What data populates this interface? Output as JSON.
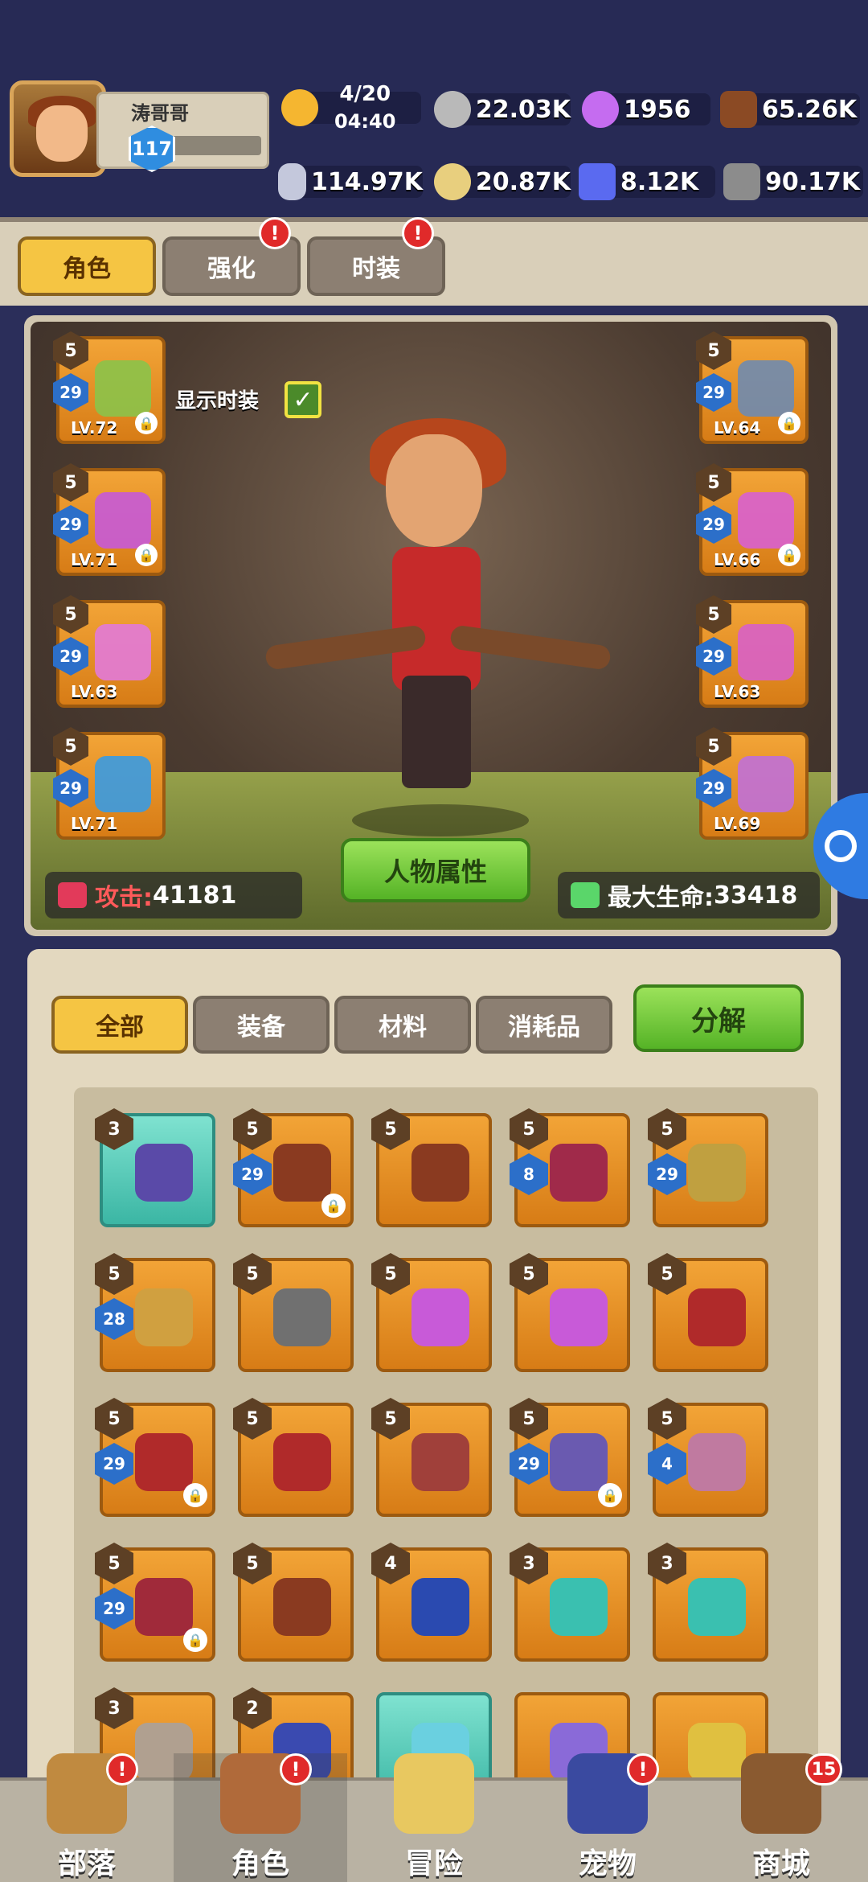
{
  "player": {
    "name": "涛哥哥",
    "level": "117"
  },
  "resources": {
    "energy": {
      "value": "4/20",
      "timer": "04:40",
      "icon": "energy-drumstick-icon",
      "color": "#f5b630"
    },
    "silver": {
      "value": "22.03K",
      "icon": "stone-coin-icon",
      "color": "#b9b9b9"
    },
    "gem": {
      "value": "1956",
      "icon": "purple-orb-icon",
      "color": "#c56cf0"
    },
    "wood": {
      "value": "65.26K",
      "icon": "wood-log-icon",
      "color": "#8b4a24"
    },
    "bone": {
      "value": "114.97K",
      "icon": "bone-icon",
      "color": "#c4c8dc"
    },
    "egg": {
      "value": "20.87K",
      "icon": "gold-egg-icon",
      "color": "#e8cf7e"
    },
    "crystal": {
      "value": "8.12K",
      "icon": "blue-crystal-icon",
      "color": "#5a6af0"
    },
    "ore": {
      "value": "90.17K",
      "icon": "grey-ore-icon",
      "color": "#8c8c8c"
    }
  },
  "tabs": [
    {
      "label": "角色",
      "active": true,
      "alert": false
    },
    {
      "label": "强化",
      "active": false,
      "alert": true
    },
    {
      "label": "时装",
      "active": false,
      "alert": true
    }
  ],
  "alert_mark": "!",
  "costume_toggle": {
    "label": "显示时装",
    "checked": true,
    "check_mark": "✓"
  },
  "equipped_left": [
    {
      "tier": "5",
      "rank": "29",
      "level": "LV.72",
      "locked": true,
      "color": "#8bc34a"
    },
    {
      "tier": "5",
      "rank": "29",
      "level": "LV.71",
      "locked": true,
      "color": "#c65ad8"
    },
    {
      "tier": "5",
      "rank": "29",
      "level": "LV.63",
      "locked": false,
      "color": "#e27ad8"
    },
    {
      "tier": "5",
      "rank": "29",
      "level": "LV.71",
      "locked": false,
      "color": "#3a9be2"
    }
  ],
  "equipped_right": [
    {
      "tier": "5",
      "rank": "29",
      "level": "LV.64",
      "locked": true,
      "color": "#6f8bb0"
    },
    {
      "tier": "5",
      "rank": "29",
      "level": "LV.66",
      "locked": true,
      "color": "#d860d0"
    },
    {
      "tier": "5",
      "rank": "29",
      "level": "LV.63",
      "locked": false,
      "color": "#d860c8"
    },
    {
      "tier": "5",
      "rank": "29",
      "level": "LV.69",
      "locked": false,
      "color": "#c070d8"
    }
  ],
  "stats": {
    "attack_label": "攻击:",
    "attack_value": "41181",
    "hp_label": "最大生命:",
    "hp_value": "33418"
  },
  "attributes_button": "人物属性",
  "inventory": {
    "tabs": [
      {
        "label": "全部",
        "active": true
      },
      {
        "label": "装备",
        "active": false
      },
      {
        "label": "材料",
        "active": false
      },
      {
        "label": "消耗品",
        "active": false
      }
    ],
    "decompose_label": "分解",
    "items": [
      {
        "tier": "3",
        "rank": "",
        "locked": false,
        "teal": true,
        "color": "#5a4aa8"
      },
      {
        "tier": "5",
        "rank": "29",
        "locked": true,
        "teal": false,
        "color": "#8a3a20"
      },
      {
        "tier": "5",
        "rank": "",
        "locked": false,
        "teal": false,
        "color": "#8a3a20"
      },
      {
        "tier": "5",
        "rank": "8",
        "locked": false,
        "teal": false,
        "color": "#a02a4a"
      },
      {
        "tier": "5",
        "rank": "29",
        "locked": false,
        "teal": false,
        "color": "#c0a040"
      },
      {
        "tier": "5",
        "rank": "28",
        "locked": false,
        "teal": false,
        "color": "#d0a040"
      },
      {
        "tier": "5",
        "rank": "",
        "locked": false,
        "teal": false,
        "color": "#707070"
      },
      {
        "tier": "5",
        "rank": "",
        "locked": false,
        "teal": false,
        "color": "#c85ad8"
      },
      {
        "tier": "5",
        "rank": "",
        "locked": false,
        "teal": false,
        "color": "#c85ad8"
      },
      {
        "tier": "5",
        "rank": "",
        "locked": false,
        "teal": false,
        "color": "#b02a2a"
      },
      {
        "tier": "5",
        "rank": "29",
        "locked": true,
        "teal": false,
        "color": "#b02a2a"
      },
      {
        "tier": "5",
        "rank": "",
        "locked": false,
        "teal": false,
        "color": "#b02a2a"
      },
      {
        "tier": "5",
        "rank": "",
        "locked": false,
        "teal": false,
        "color": "#a0403a"
      },
      {
        "tier": "5",
        "rank": "29",
        "locked": true,
        "teal": false,
        "color": "#6a5ab0"
      },
      {
        "tier": "5",
        "rank": "4",
        "locked": false,
        "teal": false,
        "color": "#c07aa0"
      },
      {
        "tier": "5",
        "rank": "29",
        "locked": true,
        "teal": false,
        "color": "#a02a3a"
      },
      {
        "tier": "5",
        "rank": "",
        "locked": false,
        "teal": false,
        "color": "#8a3a20"
      },
      {
        "tier": "4",
        "rank": "",
        "locked": false,
        "teal": false,
        "color": "#2a4ab0"
      },
      {
        "tier": "3",
        "rank": "",
        "locked": false,
        "teal": false,
        "color": "#3ac0b0"
      },
      {
        "tier": "3",
        "rank": "",
        "locked": false,
        "teal": false,
        "color": "#3ac0b0"
      },
      {
        "tier": "3",
        "rank": "",
        "locked": false,
        "teal": false,
        "color": "#b0a090"
      },
      {
        "tier": "2",
        "rank": "",
        "locked": false,
        "teal": false,
        "color": "#3a4ab0"
      },
      {
        "tier": "",
        "rank": "",
        "locked": false,
        "teal": true,
        "color": "#6ad0e0"
      },
      {
        "tier": "",
        "rank": "",
        "locked": false,
        "teal": false,
        "color": "#8a6ad8"
      },
      {
        "tier": "",
        "rank": "",
        "locked": false,
        "teal": false,
        "color": "#e0c040"
      }
    ]
  },
  "nav": [
    {
      "label": "部落",
      "icon": "tribe-tower-icon",
      "alert": true,
      "badge": "",
      "active": false,
      "color": "#c08a40"
    },
    {
      "label": "角色",
      "icon": "monkey-hero-icon",
      "alert": true,
      "badge": "",
      "active": true,
      "color": "#b06a3a"
    },
    {
      "label": "冒险",
      "icon": "treasure-map-icon",
      "alert": false,
      "badge": "",
      "active": false,
      "color": "#e8c860"
    },
    {
      "label": "宠物",
      "icon": "wolf-pet-icon",
      "alert": true,
      "badge": "",
      "active": false,
      "color": "#3a4aa0"
    },
    {
      "label": "商城",
      "icon": "shop-bag-icon",
      "alert": false,
      "badge": "15",
      "active": false,
      "color": "#8a5a30"
    }
  ]
}
